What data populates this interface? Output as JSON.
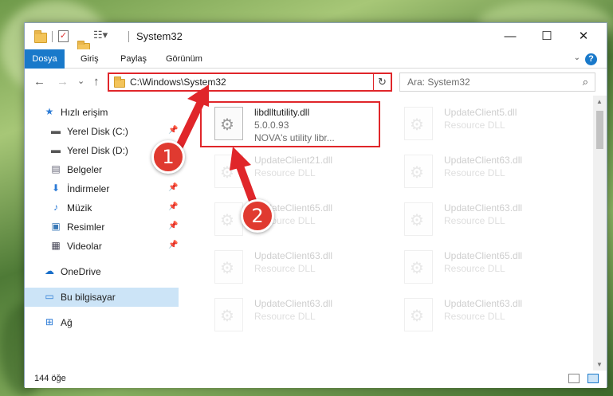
{
  "window": {
    "title": "System32",
    "controls": {
      "minimize": "—",
      "maximize": "☐",
      "close": "✕"
    }
  },
  "ribbon": {
    "tabs": [
      {
        "label": "Dosya",
        "active": true
      },
      {
        "label": "Giriş"
      },
      {
        "label": "Paylaş"
      },
      {
        "label": "Görünüm"
      }
    ],
    "help": "?"
  },
  "navigation": {
    "back": "←",
    "forward": "→",
    "recent": "⌄",
    "up": "↑",
    "address": "C:\\Windows\\System32",
    "refresh": "↻",
    "search_placeholder": "Ara: System32",
    "search_icon": "search-icon"
  },
  "sidebar": {
    "items": [
      {
        "label": "Hızlı erişim",
        "icon": "star-icon",
        "glyph": "★"
      },
      {
        "label": "Yerel Disk (C:)",
        "icon": "drive-icon",
        "glyph": "▬",
        "pinned": true
      },
      {
        "label": "Yerel Disk (D:)",
        "icon": "drive-icon",
        "glyph": "▬"
      },
      {
        "label": "Belgeler",
        "icon": "documents-icon",
        "glyph": "▤"
      },
      {
        "label": "İndirmeler",
        "icon": "downloads-icon",
        "glyph": "⬇",
        "pinned": true
      },
      {
        "label": "Müzik",
        "icon": "music-icon",
        "glyph": "♪",
        "pinned": true
      },
      {
        "label": "Resimler",
        "icon": "pictures-icon",
        "glyph": "▣",
        "pinned": true
      },
      {
        "label": "Videolar",
        "icon": "videos-icon",
        "glyph": "▦",
        "pinned": true
      },
      {
        "label": "OneDrive",
        "icon": "onedrive-icon",
        "glyph": "☁"
      },
      {
        "label": "Bu bilgisayar",
        "icon": "computer-icon",
        "glyph": "▭",
        "selected": true
      },
      {
        "label": "Ağ",
        "icon": "network-icon",
        "glyph": "⊞"
      }
    ],
    "pin_glyph": "📌"
  },
  "files": [
    {
      "name": "libdlltutility.dll",
      "line2": "5.0.0.93",
      "line3": "NOVA's utility libr...",
      "highlight": true
    },
    {
      "name": "UpdateClient5.dll",
      "line2": "Resource DLL"
    },
    {
      "name": "UpdateClient21.dll",
      "line2": "Resource DLL"
    },
    {
      "name": "UpdateClient63.dll",
      "line2": "Resource DLL"
    },
    {
      "name": "UpdateClient65.dll",
      "line2": "Resource DLL"
    },
    {
      "name": "UpdateClient63.dll",
      "line2": "Resource DLL"
    },
    {
      "name": "UpdateClient63.dll",
      "line2": "Resource DLL"
    },
    {
      "name": "UpdateClient65.dll",
      "line2": "Resource DLL"
    },
    {
      "name": "UpdateClient63.dll",
      "line2": "Resource DLL"
    },
    {
      "name": "UpdateClient63.dll",
      "line2": "Resource DLL"
    }
  ],
  "status": {
    "count": "144 öğe"
  },
  "annotations": {
    "step1": "1",
    "step2": "2"
  },
  "colors": {
    "accent": "#1979ca",
    "highlight": "#e0262a",
    "selected": "#cce4f7"
  }
}
